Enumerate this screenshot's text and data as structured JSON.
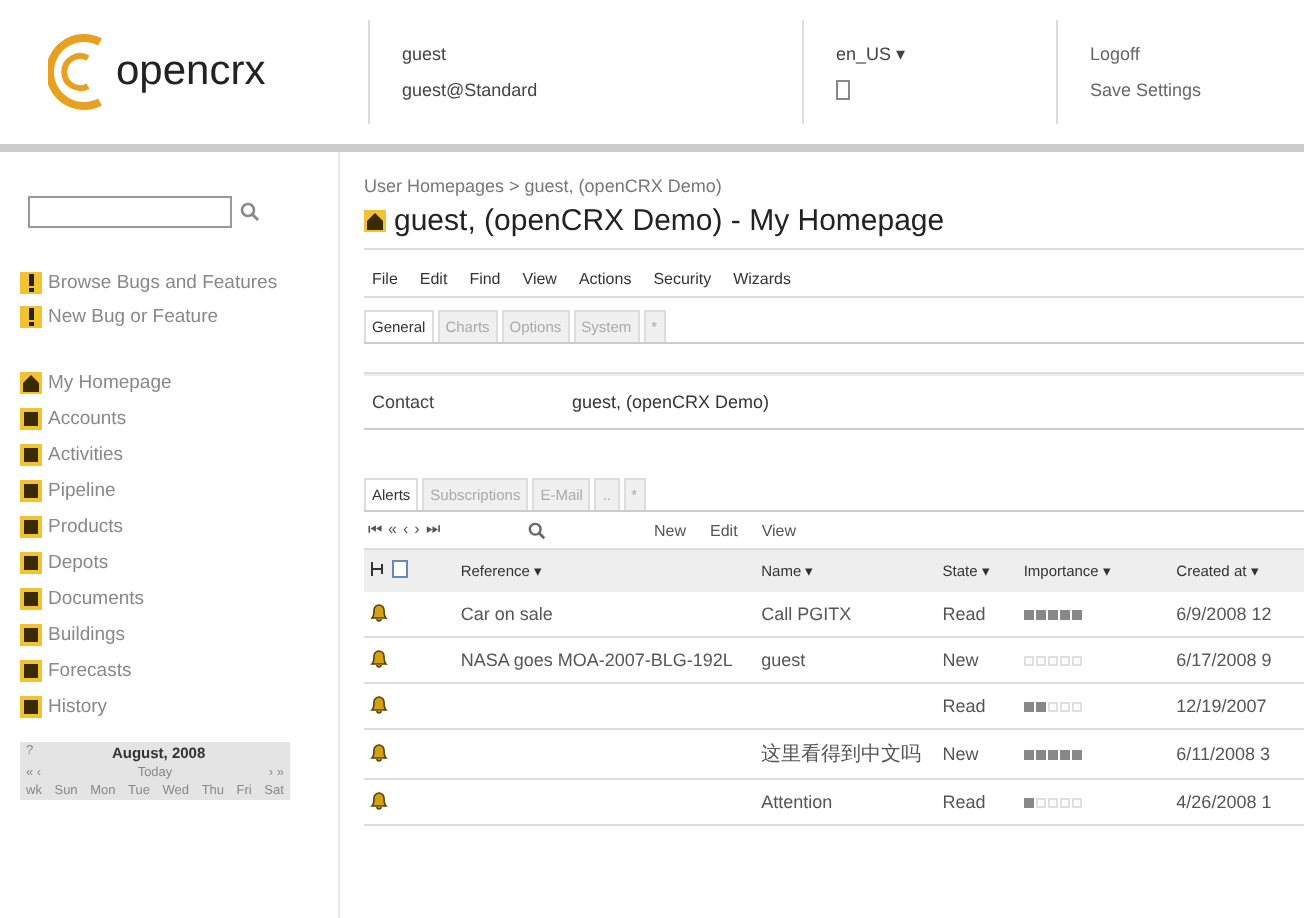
{
  "header": {
    "logo": "opencrx",
    "user": "guest",
    "user_segment": "guest@Standard",
    "locale": "en_US",
    "locale_caret": "▾",
    "links": [
      "Logoff",
      "Save Settings"
    ]
  },
  "sidebar": {
    "quick_links": [
      "Browse Bugs and Features",
      "New Bug or Feature"
    ],
    "items": [
      {
        "label": "My Homepage"
      },
      {
        "label": "Accounts"
      },
      {
        "label": "Activities"
      },
      {
        "label": "Pipeline"
      },
      {
        "label": "Products"
      },
      {
        "label": "Depots"
      },
      {
        "label": "Documents"
      },
      {
        "label": "Buildings"
      },
      {
        "label": "Forecasts"
      },
      {
        "label": "History"
      }
    ],
    "calendar": {
      "help": "?",
      "title": "August, 2008",
      "nav_left": [
        "«",
        "‹"
      ],
      "today": "Today",
      "nav_right": [
        "›",
        "»"
      ],
      "weekdays": [
        "wk",
        "Sun",
        "Mon",
        "Tue",
        "Wed",
        "Thu",
        "Fri",
        "Sat"
      ]
    }
  },
  "breadcrumb": "User Homepages > guest, (openCRX Demo)",
  "title": "guest, (openCRX Demo) - My Homepage",
  "menu": [
    "File",
    "Edit",
    "Find",
    "View",
    "Actions",
    "Security",
    "Wizards"
  ],
  "tabs": [
    {
      "label": "General",
      "selected": true
    },
    {
      "label": "Charts",
      "selected": false
    },
    {
      "label": "Options",
      "selected": false
    },
    {
      "label": "System",
      "selected": false
    },
    {
      "label": "*",
      "selected": false
    }
  ],
  "fields": [
    {
      "label": "Contact",
      "value": "guest, (openCRX Demo)"
    }
  ],
  "grid_tabs": [
    {
      "label": "Alerts",
      "selected": true
    },
    {
      "label": "Subscriptions",
      "selected": false
    },
    {
      "label": "E-Mail",
      "selected": false
    },
    {
      "label": "..",
      "selected": false
    },
    {
      "label": "*",
      "selected": false
    }
  ],
  "toolbar": {
    "pager": [
      "⏮",
      "«",
      "‹",
      "›",
      "⏭"
    ],
    "actions": [
      "New",
      "Edit",
      "View"
    ]
  },
  "table": {
    "columns": [
      "Reference ▾",
      "Name ▾",
      "State ▾",
      "Importance ▾",
      "Created at ▾"
    ],
    "rows": [
      {
        "reference": "Car on sale",
        "name": "Call PGITX",
        "state": "Read",
        "stars": 5,
        "created": "6/9/2008 12"
      },
      {
        "reference": "NASA goes MOA-2007-BLG-192L",
        "name": "guest",
        "state": "New",
        "stars": 0,
        "created": "6/17/2008 9"
      },
      {
        "reference": "",
        "name": "",
        "state": "Read",
        "stars": 2,
        "created": "12/19/2007"
      },
      {
        "reference": "",
        "name": "这里看得到中文吗",
        "state": "New",
        "stars": 5,
        "created": "6/11/2008 3"
      },
      {
        "reference": "",
        "name": "Attention",
        "state": "Read",
        "stars": 1,
        "created": "4/26/2008 1"
      }
    ]
  }
}
